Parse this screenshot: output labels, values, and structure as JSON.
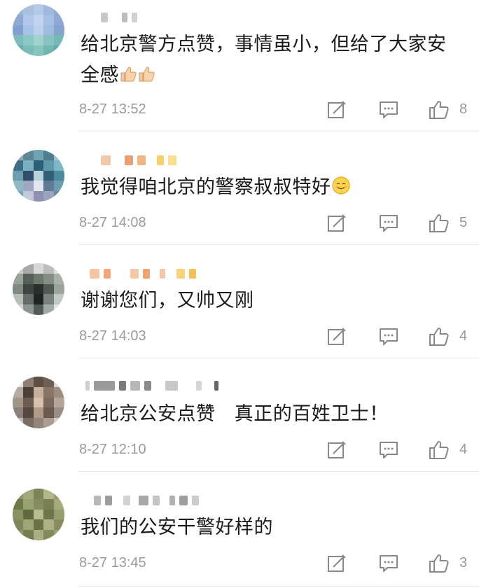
{
  "comments": [
    {
      "text": "给北京警方点赞，事情虽小，但给了大家安全感",
      "line1": "给北京警方点赞，事情虽小，但给了大家安",
      "line2": "全感",
      "emoji": "thumbs-up-icon x2",
      "time": "8-27 13:52",
      "likes": "8"
    },
    {
      "text": "我觉得咱北京的警察叔叔特好",
      "emoji": "smiling-face-icon",
      "time": "8-27 14:08",
      "likes": "5"
    },
    {
      "text": "谢谢您们，又帅又刚",
      "time": "8-27 14:03",
      "likes": "4"
    },
    {
      "text": "给北京公安点赞   真正的百姓卫士！",
      "time": "8-27 12:10",
      "likes": "4"
    },
    {
      "text": "我们的公安干警好样的",
      "time": "8-27 13:45",
      "likes": "3"
    }
  ],
  "icons": {
    "forward": "share-edit-icon",
    "reply": "comment-bubble-icon",
    "like": "thumbs-up-icon"
  },
  "colors": {
    "meta": "#9a9a9a",
    "text": "#1a1a1a",
    "divider": "#e6e6e6"
  }
}
